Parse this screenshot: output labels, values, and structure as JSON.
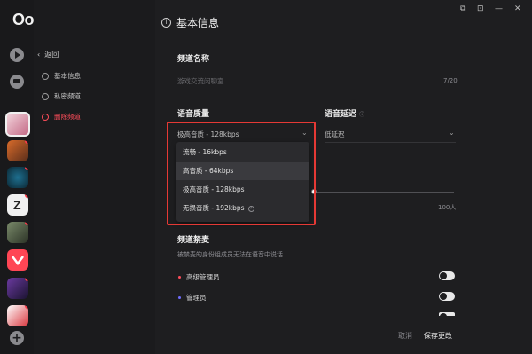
{
  "app": {
    "logo": "Oopz."
  },
  "window": {
    "controls": [
      "⧉",
      "⊡",
      "—",
      "✕"
    ]
  },
  "nav": {
    "back": "返回",
    "items": [
      {
        "label": "基本信息",
        "icon": "info-icon"
      },
      {
        "label": "私密频道",
        "icon": "user-lock-icon"
      },
      {
        "label": "删除频道",
        "icon": "trash-icon"
      }
    ]
  },
  "header": {
    "title": "基本信息"
  },
  "channel_name": {
    "label": "频道名称",
    "placeholder": "游戏交流闲聊室",
    "counter": "7/20"
  },
  "voice_quality": {
    "label": "语音质量",
    "selected": "极高音质 - 128kbps",
    "options": [
      {
        "label": "流畅 - 16kbps"
      },
      {
        "label": "高音质 - 64kbps"
      },
      {
        "label": "极高音质 - 128kbps"
      },
      {
        "label": "无损音质 - 192kbps"
      }
    ]
  },
  "voice_delay": {
    "label": "语音延迟",
    "selected": "低延迟"
  },
  "member_limit": {
    "value_label": "100人",
    "fill": 1.0
  },
  "mic_ban": {
    "label": "频道禁麦",
    "description": "被禁麦的身份组成员无法在语音中说话",
    "roles": [
      {
        "label": "高级管理员",
        "color": "#ff4d5a"
      },
      {
        "label": "管理员",
        "color": "#6f6cff"
      }
    ]
  },
  "footer": {
    "cancel": "取消",
    "save": "保存更改"
  },
  "colors": {
    "accent_red": "#e53935",
    "danger": "#ff4d5a"
  }
}
